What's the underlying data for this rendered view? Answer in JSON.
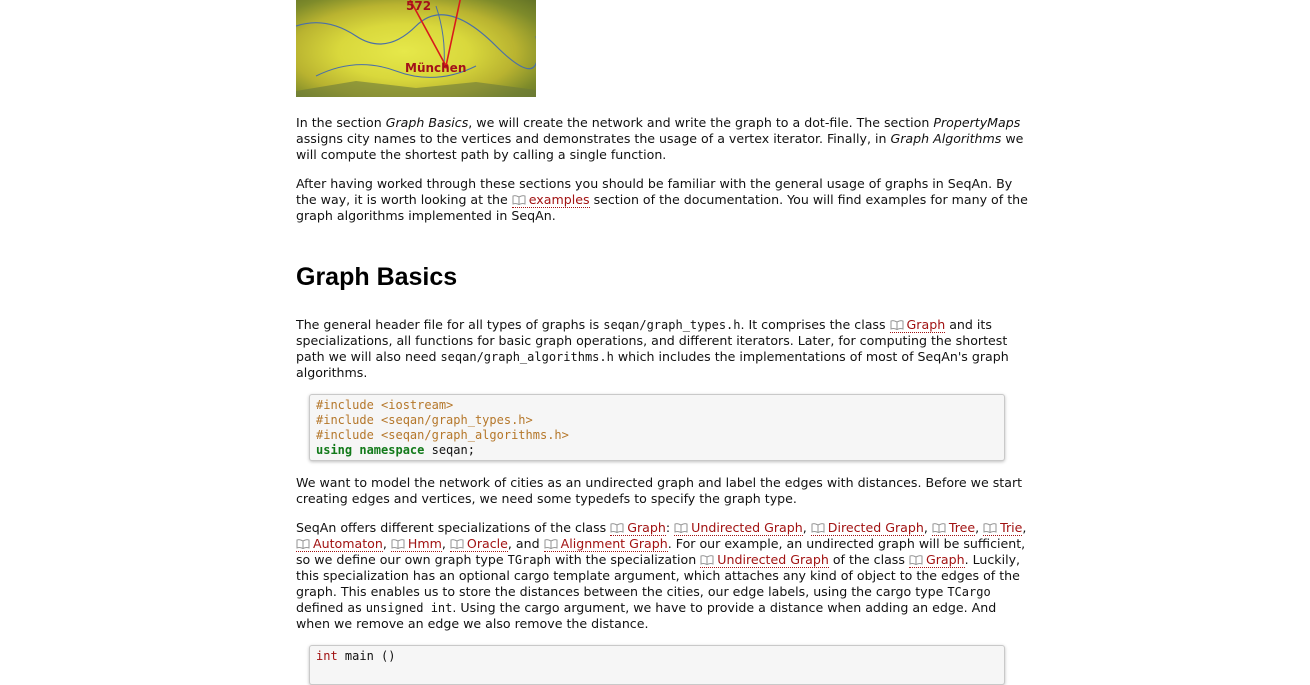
{
  "map": {
    "distance_label": "572",
    "city_label": "München"
  },
  "intro": {
    "p1": {
      "a": "In the section ",
      "graph_basics": "Graph Basics",
      "b": ", we will create the network and write the graph to a dot-file. The section ",
      "property_maps": "PropertyMaps",
      "c": " assigns city names to the vertices and demonstrates the usage of a vertex iterator. Finally, in ",
      "graph_algorithms": "Graph Algorithms",
      "d": " we will compute the shortest path by calling a single function."
    },
    "p2": {
      "a": "After having worked through these sections you should be familiar with the general usage of graphs in SeqAn. By the way, it is worth looking at the ",
      "link": "examples",
      "b": " section of the documentation. You will find examples for many of the graph algorithms implemented in SeqAn."
    }
  },
  "section_title": "Graph Basics",
  "basics": {
    "p1": {
      "a": "The general header file for all types of graphs is ",
      "code1": "seqan/graph_types.h",
      "b": ". It comprises the class ",
      "link_graph": "Graph",
      "c": " and its specializations, all functions for basic graph operations, and different iterators. Later, for computing the shortest path we will also need ",
      "code2": "seqan/graph_algorithms.h",
      "d": " which includes the implementations of most of SeqAn's graph algorithms."
    },
    "code_block": {
      "line1": "#include <iostream>",
      "line2": "#include <seqan/graph_types.h>",
      "line3": "#include <seqan/graph_algorithms.h>",
      "line4_kw": "using namespace",
      "line4_rest": " seqan;"
    },
    "p2": "We want to model the network of cities as an undirected graph and label the edges with distances. Before we start creating edges and vertices, we need some typedefs to specify the graph type.",
    "p3": {
      "a": "SeqAn offers different specializations of the class ",
      "l_graph": "Graph",
      "l_undirected": "Undirected Graph",
      "l_directed": "Directed Graph",
      "l_tree": "Tree",
      "l_trie": "Trie",
      "l_automaton": "Automaton",
      "l_hmm": "Hmm",
      "l_oracle": "Oracle",
      "and": ", and ",
      "l_alignment": "Alignment Graph",
      "b": ". For our example, an undirected graph will be sufficient, so we define our own graph type ",
      "tgraph": "TGraph",
      "c": " with the specialization ",
      "l_undirected2": "Undirected Graph",
      "d": " of the class ",
      "l_graph2": "Graph",
      "e": ". Luckily, this specialization has an optional cargo template argument, which attaches any kind of object to the edges of the graph. This enables us to store the distances between the cities, our edge labels, using the cargo type ",
      "tcargo": "TCargo",
      "f": " defined as ",
      "uint": "unsigned int",
      "g": ". Using the cargo argument, we have to provide a distance when adding an edge. And when we remove an edge we also remove the distance."
    },
    "code_block2": {
      "type": "int",
      "rest": " main ()"
    }
  },
  "colors": {
    "link": "#a11212",
    "preprocessor": "#b5772a",
    "keyword": "#127a1a"
  }
}
